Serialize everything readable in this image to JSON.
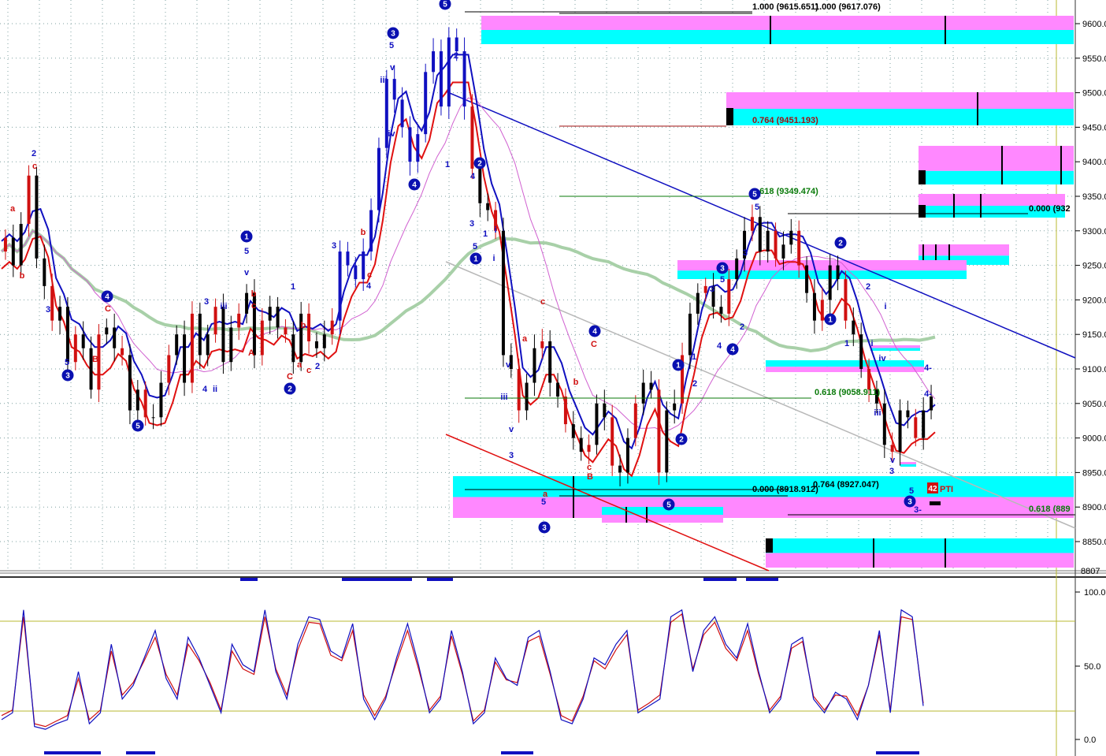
{
  "price_axis_labels": [
    "9600.0",
    "9550.0",
    "9500.0",
    "9450.0",
    "9400.0",
    "9350.0",
    "9300.0",
    "9250.0",
    "9200.0",
    "9150.0",
    "9100.0",
    "9050.0",
    "9000.0",
    "8950.0",
    "8900.0",
    "8850.0"
  ],
  "price_axis_cut_label": "8807",
  "osc_axis_labels": [
    "100.0",
    "50.0",
    "0.0"
  ],
  "fib_labels": {
    "f1000": "1.000 (9615.651)",
    "f1000b": "1.000 (9617.076)",
    "f764a": "0.764 (9451.193)",
    "f618a": "0.618 (9349.474)",
    "f000a": "0.000 (932",
    "f618b": "0.618 (9058.911)",
    "f764b": "0.764 (8927.047)",
    "f000b": "0.000 (8918.912)",
    "f618c": "0.618 (889"
  },
  "pti_tag": {
    "value": "42",
    "label": "PTI"
  },
  "wave_labels": {
    "blue": [
      "3",
      "5",
      "v",
      "iii",
      "iv",
      "4",
      "5",
      "3",
      "1",
      "5",
      "1",
      "i",
      "i",
      "ii",
      "v",
      "iii",
      "2",
      "1",
      "ii",
      "4",
      "5",
      "3",
      "4",
      "i",
      "3",
      "v",
      "iii",
      "ii",
      "1",
      "4",
      "2",
      "5",
      "1",
      "3",
      "5",
      "4",
      "3",
      "2",
      "1",
      "i",
      "iv",
      "iii",
      "v",
      "3",
      "5",
      "3",
      "1",
      "2",
      "3",
      "iv",
      "i",
      "i",
      "v",
      "3",
      "4",
      "4-",
      "4",
      "5",
      "3-"
    ],
    "red": [
      "a",
      "b",
      "c",
      "2",
      "c",
      "B",
      "C",
      "A",
      "b",
      "c",
      "C",
      "a",
      "c",
      "b",
      "c",
      "2",
      "a",
      "c",
      "b",
      "B",
      "a",
      "5",
      "b",
      "c",
      "A",
      "C",
      "4",
      "4"
    ]
  },
  "colors": {
    "cyan_zone": "#00ffff",
    "magenta_zone": "#ff88ff",
    "fast_ma": "#e01010",
    "slow_ma": "#1010c0",
    "long_ma": "#a8d0a8",
    "mid_ma": "#d060d0",
    "fib_green": "#0a7a0a",
    "fib_red": "#a01010",
    "wave_circle": "#0a10b0"
  },
  "chart_data": [
    {
      "type": "candlestick",
      "title": "",
      "ylim": [
        8807,
        9615
      ],
      "y_ticks": [
        9600,
        9550,
        9500,
        9450,
        9400,
        9350,
        9300,
        9250,
        9200,
        9150,
        9100,
        9050,
        9000,
        8950,
        8900,
        8850
      ],
      "price_path": [
        9270,
        9290,
        9250,
        9310,
        9380,
        9260,
        9220,
        9170,
        9190,
        9110,
        9150,
        9130,
        9070,
        9150,
        9160,
        9130,
        9120,
        9040,
        9070,
        9030,
        9030,
        9080,
        9120,
        9150,
        9080,
        9180,
        9120,
        9150,
        9190,
        9110,
        9160,
        9180,
        9210,
        9120,
        9170,
        9190,
        9160,
        9150,
        9110,
        9180,
        9140,
        9130,
        9150,
        9170,
        9270,
        9250,
        9230,
        9270,
        9330,
        9420,
        9520,
        9490,
        9450,
        9400,
        9440,
        9530,
        9560,
        9480,
        9580,
        9560,
        9480,
        9390,
        9340,
        9330,
        9300,
        9120,
        9100,
        9040,
        9080,
        9130,
        9140,
        9080,
        9060,
        9020,
        9000,
        8980,
        8990,
        9050,
        9030,
        8960,
        8950,
        9000,
        9050,
        9080,
        9070,
        8950,
        9040,
        9050,
        9120,
        9180,
        9210,
        9220,
        9190,
        9180,
        9230,
        9260,
        9300,
        9320,
        9270,
        9300,
        9260,
        9280,
        9300,
        9250,
        9210,
        9170,
        9200,
        9250,
        9230,
        9170,
        9150,
        9100,
        9070,
        9050,
        8990,
        8980,
        9040,
        9030,
        9000,
        9040,
        9060
      ],
      "fib_levels": [
        {
          "ratio": "1.000",
          "price": 9615.651
        },
        {
          "ratio": "1.000",
          "price": 9617.076
        },
        {
          "ratio": "0.764",
          "price": 9451.193
        },
        {
          "ratio": "0.618",
          "price": 9349.474
        },
        {
          "ratio": "0.618",
          "price": 9058.911
        },
        {
          "ratio": "0.764",
          "price": 8927.047
        },
        {
          "ratio": "0.000",
          "price": 8918.912
        }
      ]
    },
    {
      "type": "line",
      "title": "",
      "ylim": [
        0,
        100
      ],
      "y_ticks": [
        100,
        50,
        0
      ],
      "series": [
        {
          "values": [
            15,
            20,
            95,
            10,
            8,
            12,
            15,
            50,
            12,
            20,
            70,
            30,
            40,
            60,
            80,
            45,
            30,
            75,
            60,
            40,
            20,
            70,
            55,
            50,
            95,
            50,
            30,
            70,
            90,
            88,
            65,
            60,
            85,
            30,
            15,
            30,
            60,
            85,
            55,
            20,
            30,
            80,
            50,
            12,
            20,
            60,
            45,
            40,
            75,
            80,
            50,
            15,
            12,
            30,
            60,
            55,
            70,
            80,
            20,
            25,
            30,
            90,
            95,
            50,
            80,
            90,
            70,
            60,
            85,
            50,
            20,
            30,
            70,
            75,
            30,
            20,
            35,
            30,
            15,
            40,
            80,
            20,
            95,
            90,
            25
          ]
        },
        {
          "values": [
            18,
            22,
            90,
            12,
            10,
            14,
            18,
            45,
            15,
            22,
            65,
            33,
            42,
            58,
            75,
            48,
            33,
            70,
            58,
            42,
            22,
            65,
            52,
            48,
            90,
            52,
            33,
            66,
            86,
            85,
            62,
            58,
            80,
            33,
            18,
            32,
            57,
            80,
            52,
            22,
            32,
            76,
            48,
            14,
            22,
            57,
            44,
            42,
            72,
            76,
            48,
            18,
            14,
            32,
            58,
            52,
            66,
            77,
            22,
            27,
            33,
            86,
            92,
            52,
            77,
            86,
            67,
            58,
            80,
            48,
            22,
            32,
            67,
            72,
            32,
            22,
            33,
            32,
            18,
            40,
            77,
            22,
            90,
            88,
            27
          ]
        }
      ]
    }
  ]
}
